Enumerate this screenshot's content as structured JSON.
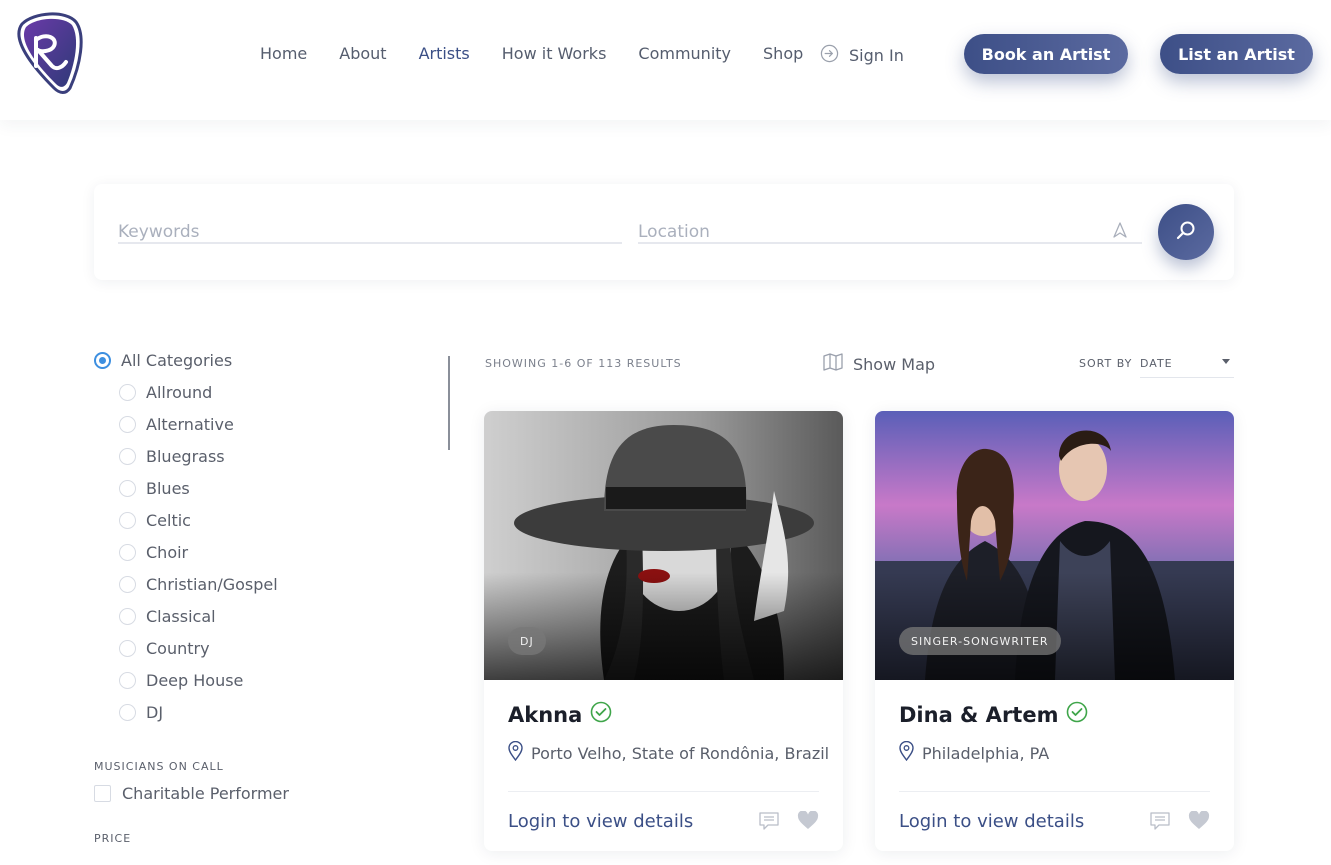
{
  "header": {
    "nav": [
      {
        "label": "Home",
        "active": false
      },
      {
        "label": "About",
        "active": false
      },
      {
        "label": "Artists",
        "active": true
      },
      {
        "label": "How it Works",
        "active": false
      },
      {
        "label": "Community",
        "active": false
      },
      {
        "label": "Shop",
        "active": false
      }
    ],
    "signin_label": "Sign In",
    "book_label": "Book an Artist",
    "list_label": "List an Artist",
    "colors": {
      "accent": "#3d4f87",
      "active_nav": "#3b4f86",
      "radio_on": "#3d8fe0"
    }
  },
  "search": {
    "keywords_placeholder": "Keywords",
    "location_placeholder": "Location"
  },
  "sidebar": {
    "categories": [
      {
        "label": "All Categories",
        "selected": true
      },
      {
        "label": "Allround",
        "selected": false
      },
      {
        "label": "Alternative",
        "selected": false
      },
      {
        "label": "Bluegrass",
        "selected": false
      },
      {
        "label": "Blues",
        "selected": false
      },
      {
        "label": "Celtic",
        "selected": false
      },
      {
        "label": "Choir",
        "selected": false
      },
      {
        "label": "Christian/Gospel",
        "selected": false
      },
      {
        "label": "Classical",
        "selected": false
      },
      {
        "label": "Country",
        "selected": false
      },
      {
        "label": "Deep House",
        "selected": false
      },
      {
        "label": "DJ",
        "selected": false
      }
    ],
    "musicians_label": "MUSICIANS ON CALL",
    "charitable_label": "Charitable Performer",
    "price_label": "PRICE"
  },
  "results": {
    "showing_text": "SHOWING 1-6 OF 113 RESULTS",
    "show_map_label": "Show Map",
    "sort_by_label": "SORT BY",
    "sort_value": "DATE"
  },
  "cards": [
    {
      "badge": "DJ",
      "name": "Aknna",
      "location": "Porto Velho, State of Rondônia, Brazil",
      "link": "Login to view details"
    },
    {
      "badge": "SINGER-SONGWRITER",
      "name": "Dina & Artem",
      "location": "Philadelphia, PA",
      "link": "Login to view details"
    }
  ]
}
